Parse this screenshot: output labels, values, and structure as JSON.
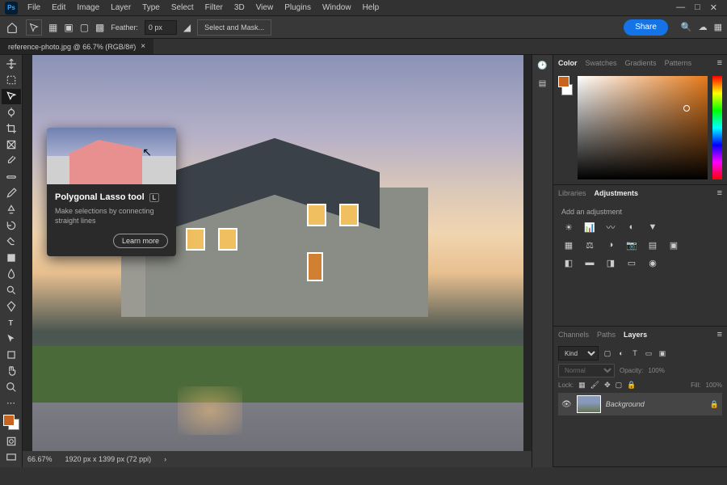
{
  "app": {
    "logo": "Ps"
  },
  "menubar": [
    "File",
    "Edit",
    "Image",
    "Layer",
    "Type",
    "Select",
    "Filter",
    "3D",
    "View",
    "Plugins",
    "Window",
    "Help"
  ],
  "optionsbar": {
    "feather_label": "Feather:",
    "feather_value": "0 px",
    "select_mask": "Select and Mask...",
    "share": "Share"
  },
  "document": {
    "tab_title": "reference-photo.jpg @ 66.7% (RGB/8#)",
    "zoom": "66.67%",
    "doc_info": "1920 px x 1399 px (72 ppi)"
  },
  "tooltip": {
    "title": "Polygonal Lasso tool",
    "shortcut": "L",
    "description": "Make selections by connecting straight lines",
    "learn_more": "Learn more"
  },
  "panels": {
    "color_tabs": [
      "Color",
      "Swatches",
      "Gradients",
      "Patterns"
    ],
    "libraries_tabs": [
      "Libraries",
      "Adjustments"
    ],
    "adj_label": "Add an adjustment",
    "layers_tabs": [
      "Channels",
      "Paths",
      "Layers"
    ],
    "layers_filter": "Kind",
    "blend_mode": "Normal",
    "opacity_label": "Opacity:",
    "opacity_value": "100%",
    "lock_label": "Lock:",
    "fill_label": "Fill:",
    "fill_value": "100%",
    "layer_name": "Background"
  },
  "colors": {
    "foreground": "#c8641e",
    "background": "#ffffff"
  }
}
